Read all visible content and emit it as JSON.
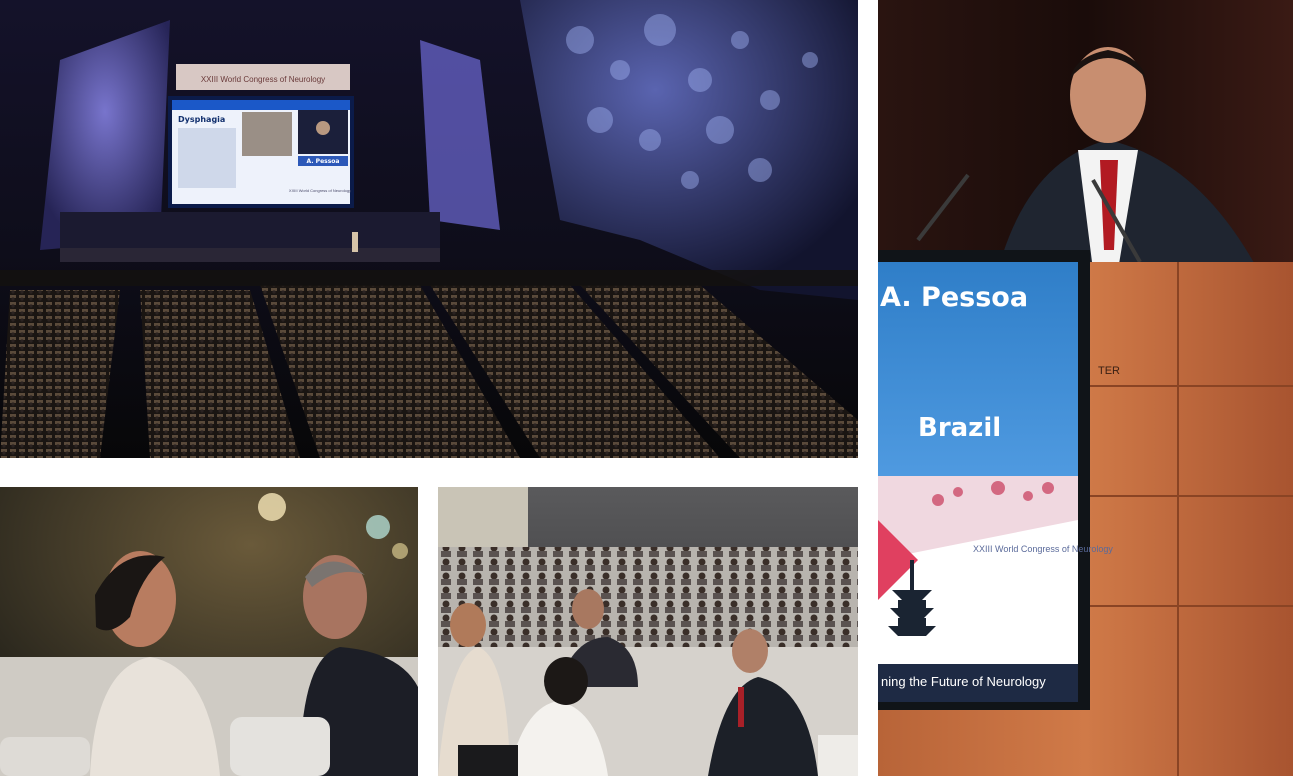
{
  "collage": {
    "hall": {
      "screen_banner": "XXIII World Congress of Neurology",
      "slide_title": "Dysphagia",
      "slide_speaker": "A. Pessoa",
      "slide_logo": "XXIII World Congress of Neurology"
    },
    "speaker": {
      "name": "A. Pessoa",
      "country": "Brazil",
      "congress": "XXIII World Congress of Neurology",
      "tagline_fragment": "ning the Future of Neurology",
      "podium_fragment": "TER"
    },
    "audience_closeup": {},
    "audience_wide": {}
  }
}
